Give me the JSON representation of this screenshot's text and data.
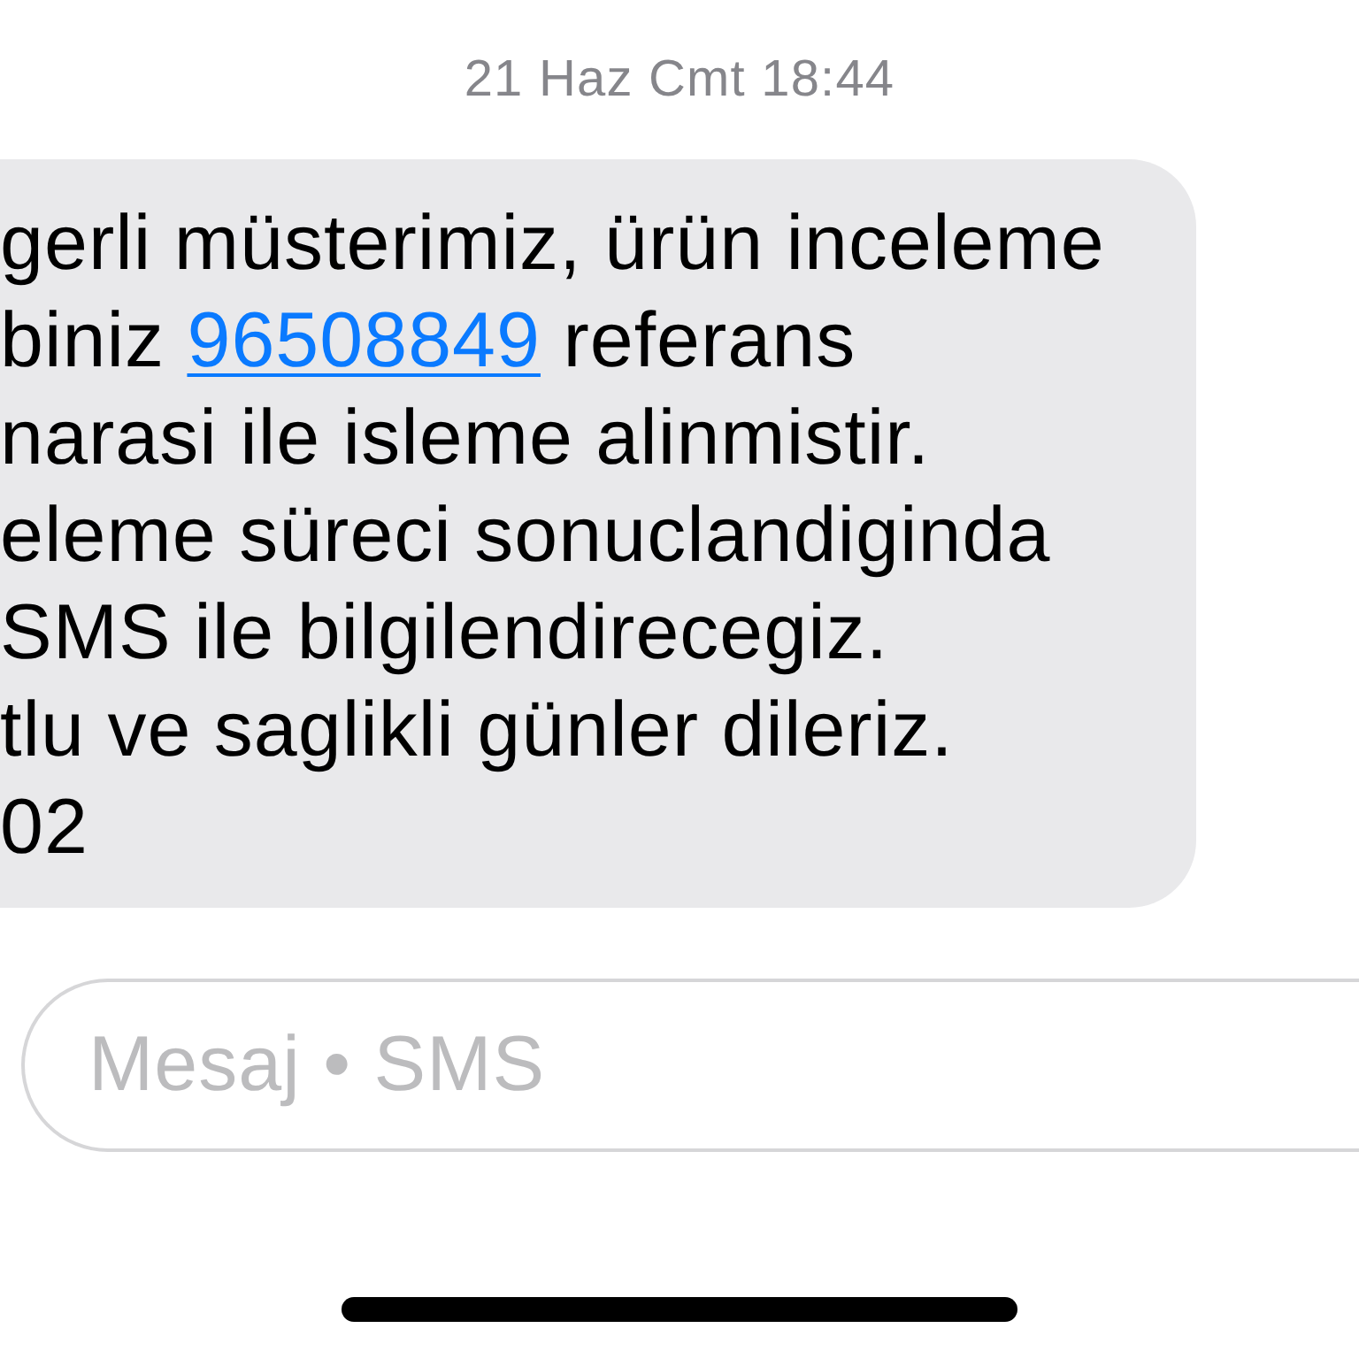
{
  "timestamp": "21 Haz Cmt 18:44",
  "message": {
    "lines": [
      [
        {
          "kind": "text",
          "text": "gerli müsterimiz, ürün inceleme"
        }
      ],
      [
        {
          "kind": "text",
          "text": "biniz "
        },
        {
          "kind": "link",
          "text": "96508849"
        },
        {
          "kind": "text",
          "text": " referans"
        }
      ],
      [
        {
          "kind": "text",
          "text": "narasi ile isleme alinmistir."
        }
      ],
      [
        {
          "kind": "text",
          "text": "eleme süreci sonuclandiginda"
        }
      ],
      [
        {
          "kind": "text",
          "text": "SMS ile bilgilendirecegiz."
        }
      ],
      [
        {
          "kind": "text",
          "text": "tlu ve saglikli günler dileriz."
        }
      ],
      [
        {
          "kind": "text",
          "text": "02"
        }
      ]
    ]
  },
  "compose": {
    "placeholder": "Mesaj • SMS"
  }
}
